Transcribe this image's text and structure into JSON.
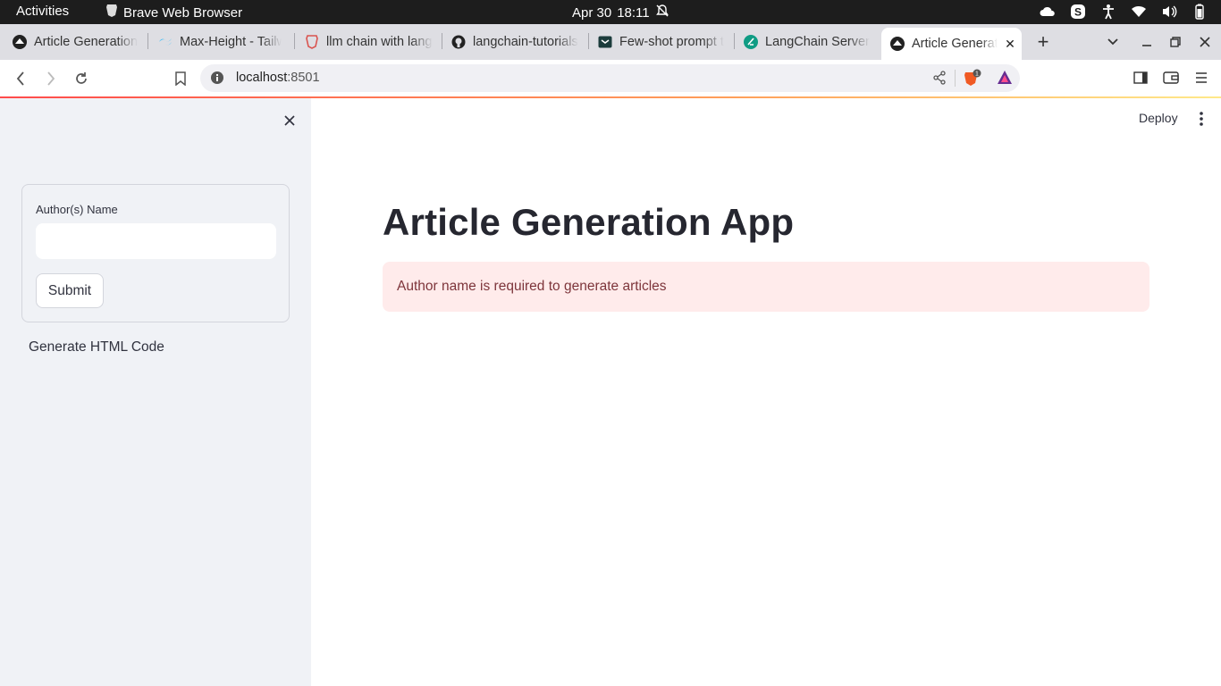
{
  "system_bar": {
    "activities": "Activities",
    "app_name": "Brave Web Browser",
    "date": "Apr 30",
    "time": "18:11"
  },
  "tabs": [
    {
      "title": "Article Generation App",
      "icon": "streamlit-icon"
    },
    {
      "title": "Max-Height - Tailwind CSS",
      "icon": "tailwind-icon"
    },
    {
      "title": "llm chain with langchain",
      "icon": "brave-search-icon"
    },
    {
      "title": "langchain-tutorials",
      "icon": "github-icon"
    },
    {
      "title": "Few-shot prompt templates",
      "icon": "docs-icon"
    },
    {
      "title": "LangChain Server",
      "icon": "langchain-icon"
    },
    {
      "title": "Article Generation App",
      "icon": "streamlit-icon",
      "active": true
    }
  ],
  "address_bar": {
    "host": "localhost",
    "port": ":8501",
    "shields_count": "1"
  },
  "sidebar": {
    "input_label": "Author(s) Name",
    "input_value": "",
    "input_placeholder": "",
    "submit_label": "Submit",
    "generate_link": "Generate HTML Code"
  },
  "main": {
    "deploy_label": "Deploy",
    "title": "Article Generation App",
    "error_message": "Author name is required to generate articles"
  },
  "colors": {
    "sidebar_bg": "#f0f2f6",
    "error_bg": "#ffebeb",
    "error_text": "#7d353b",
    "accent_red": "#ff4b4b"
  }
}
